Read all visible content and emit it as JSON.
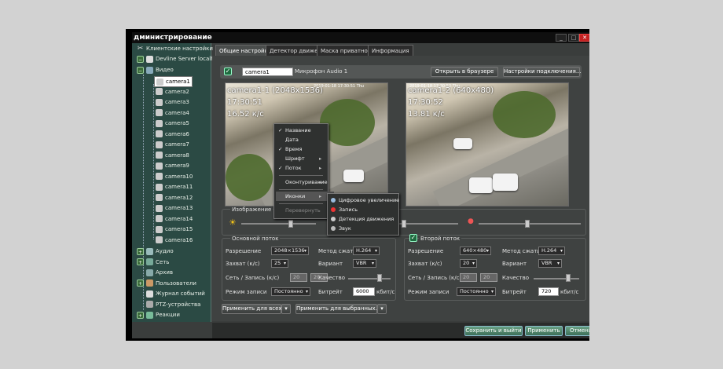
{
  "window": {
    "title": "дминистрирование",
    "min": "_",
    "max": "□",
    "close": "✕"
  },
  "sidebar": {
    "items": [
      {
        "label": "Клиентские настройки"
      },
      {
        "label": "Devline Server localhost:9780"
      },
      {
        "label": "Видео"
      },
      {
        "label": "camera1"
      },
      {
        "label": "camera2"
      },
      {
        "label": "camera3"
      },
      {
        "label": "camera4"
      },
      {
        "label": "camera5"
      },
      {
        "label": "camera6"
      },
      {
        "label": "camera7"
      },
      {
        "label": "camera8"
      },
      {
        "label": "camera9"
      },
      {
        "label": "camera10"
      },
      {
        "label": "camera11"
      },
      {
        "label": "camera12"
      },
      {
        "label": "camera13"
      },
      {
        "label": "camera14"
      },
      {
        "label": "camera15"
      },
      {
        "label": "camera16"
      },
      {
        "label": "Аудио"
      },
      {
        "label": "Сеть"
      },
      {
        "label": "Архив"
      },
      {
        "label": "Пользователи"
      },
      {
        "label": "Журнал событий"
      },
      {
        "label": "PTZ-устройства"
      },
      {
        "label": "Реакции"
      }
    ]
  },
  "tabs": [
    {
      "label": "Общие настройки"
    },
    {
      "label": "Детектор движения"
    },
    {
      "label": "Маска приватности"
    },
    {
      "label": "Информация"
    }
  ],
  "topbar": {
    "camera_name": "camera1",
    "mic_label": "Микрофон Audio 1",
    "open_browser": "Открыть в браузере",
    "connection_settings": "Настройки подключения..."
  },
  "preview1": {
    "name": "camera1-1 (2048x1536)",
    "time": "17:30:51",
    "fps": "16.52 к/с",
    "stamp": "2019-01-18 17:30:51 Thu"
  },
  "preview2": {
    "name": "camera1-2 (640x480)",
    "time": "17:30:52",
    "fps": "13.81 к/с",
    "stamp": "2019-01-18 17:30:52 Thu"
  },
  "context_menu": {
    "items": [
      "Название",
      "Дата",
      "Время",
      "Шрифт",
      "Поток",
      "Оконтуривание",
      "Иконки",
      "Перевернуть"
    ],
    "arrow": "▸"
  },
  "submenu": {
    "items": [
      "Цифровое увеличение",
      "Запись",
      "Детекция движения",
      "Звук"
    ]
  },
  "image_group": {
    "label": "Изображение"
  },
  "main_stream": {
    "label": "Основной поток",
    "resolution_label": "Разрешение",
    "resolution": "2048×1536",
    "capture_label": "Захват (к/с)",
    "capture": "25",
    "network_label": "Сеть / Запись (к/с)",
    "network1": "20",
    "network2": "20",
    "mode_label": "Режим записи",
    "mode": "Постоянно",
    "codec_label": "Метод сжатия",
    "codec": "H.264",
    "variant_label": "Вариант",
    "variant": "VBR",
    "quality_label": "Качество",
    "bitrate_label": "Битрейт",
    "bitrate": "6000",
    "bitrate_unit": "кбит/с"
  },
  "second_stream": {
    "label": "Второй поток",
    "resolution_label": "Разрешение",
    "resolution": "640×480",
    "capture_label": "Захват (к/с)",
    "capture": "20",
    "network_label": "Сеть / Запись (к/с)",
    "network1": "20",
    "network2": "20",
    "mode_label": "Режим записи",
    "mode": "Постоянно",
    "codec_label": "Метод сжатия",
    "codec": "H.264",
    "variant_label": "Вариант",
    "variant": "VBR",
    "quality_label": "Качество",
    "bitrate_label": "Битрейт",
    "bitrate": "720",
    "bitrate_unit": "кбит/с"
  },
  "apply_buttons": {
    "apply_all": "Применить для всех",
    "apply_selected": "Применить для выбранных..."
  },
  "bottom": {
    "save_exit": "Сохранить и выйти",
    "apply": "Применить",
    "cancel": "Отмена"
  }
}
